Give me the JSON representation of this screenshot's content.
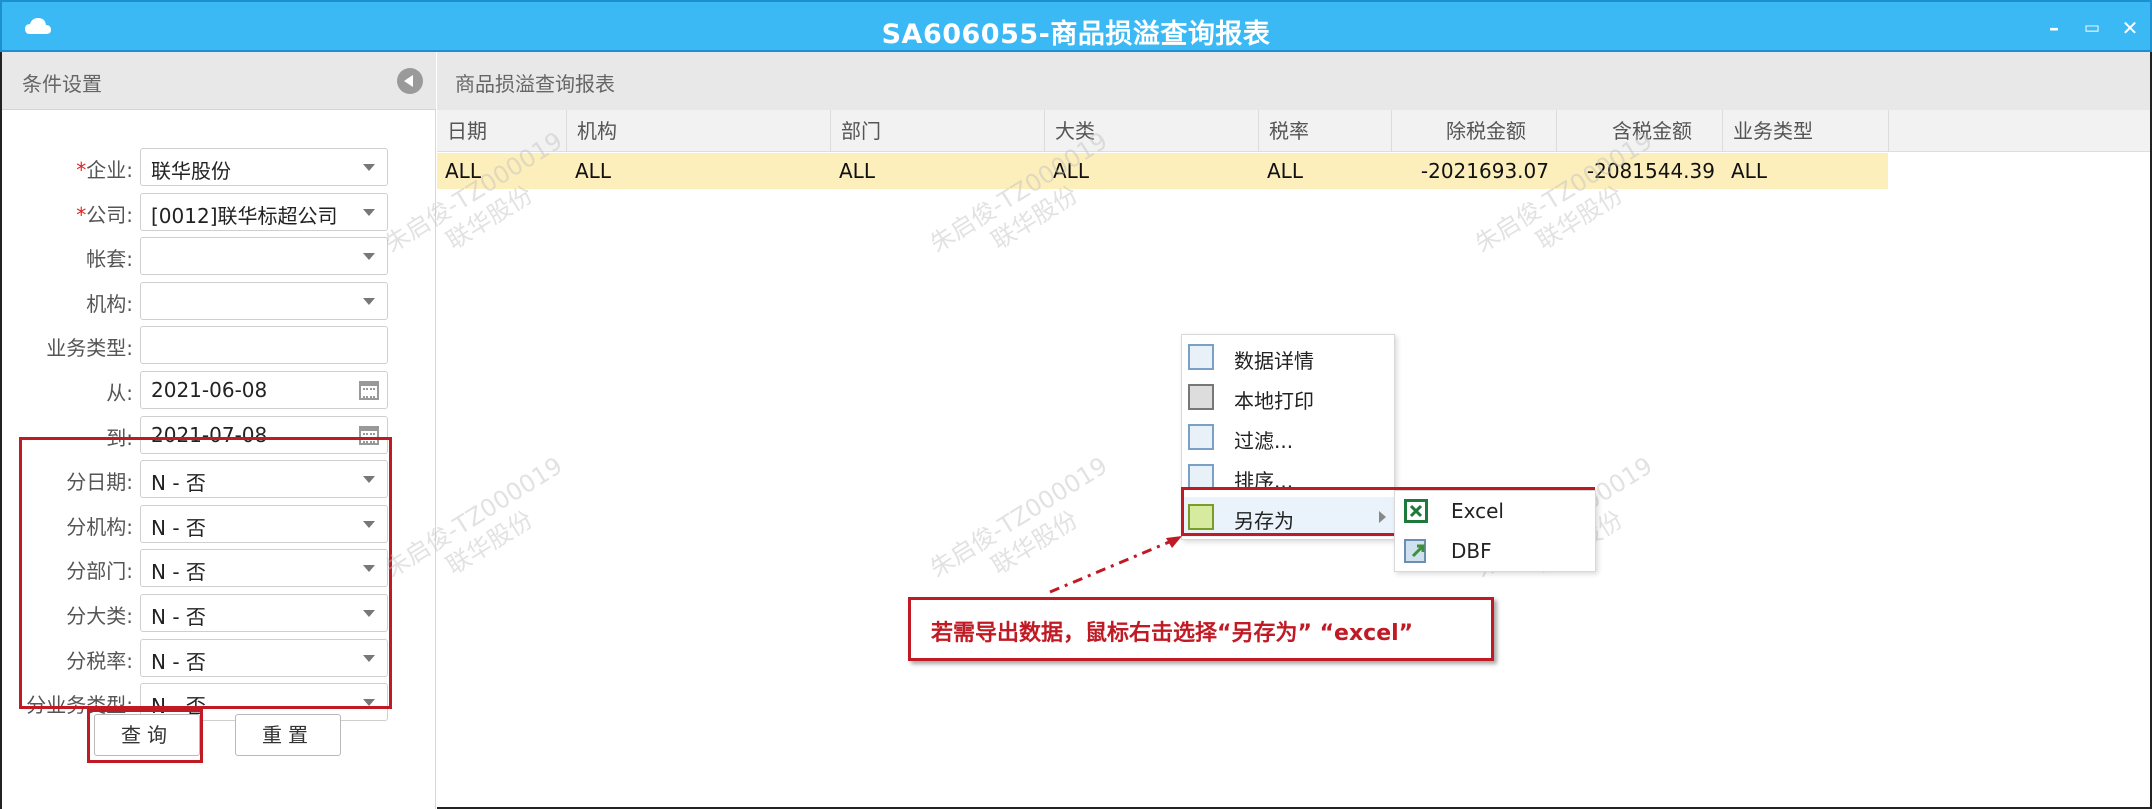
{
  "window": {
    "title": "SA606055-商品损溢查询报表",
    "minimize": "–",
    "restore": "▭",
    "close": "✕"
  },
  "left_panel": {
    "title": "条件设置",
    "fields": [
      {
        "label": "企业:",
        "required": true,
        "value": "联华股份",
        "type": "select"
      },
      {
        "label": "公司:",
        "required": true,
        "value": "[0012]联华标超公司",
        "type": "select"
      },
      {
        "label": "帐套:",
        "required": false,
        "value": "",
        "type": "select"
      },
      {
        "label": "机构:",
        "required": false,
        "value": "",
        "type": "select"
      },
      {
        "label": "业务类型:",
        "required": false,
        "value": "",
        "type": "text"
      },
      {
        "label": "从:",
        "required": false,
        "value": "2021-06-08",
        "type": "date"
      },
      {
        "label": "到:",
        "required": false,
        "value": "2021-07-08",
        "type": "date"
      },
      {
        "label": "分日期:",
        "required": false,
        "value": "N - 否",
        "type": "select"
      },
      {
        "label": "分机构:",
        "required": false,
        "value": "N - 否",
        "type": "select"
      },
      {
        "label": "分部门:",
        "required": false,
        "value": "N - 否",
        "type": "select"
      },
      {
        "label": "分大类:",
        "required": false,
        "value": "N - 否",
        "type": "select"
      },
      {
        "label": "分税率:",
        "required": false,
        "value": "N - 否",
        "type": "select"
      },
      {
        "label": "分业务类型:",
        "required": false,
        "value": "N - 否",
        "type": "select"
      }
    ],
    "query_button": "查询",
    "reset_button": "重置"
  },
  "report": {
    "title": "商品损溢查询报表",
    "columns": [
      "日期",
      "机构",
      "部门",
      "大类",
      "税率",
      "除税金额",
      "含税金额",
      "业务类型"
    ],
    "rows": [
      [
        "ALL",
        "ALL",
        "ALL",
        "ALL",
        "ALL",
        "-2021693.07",
        "-2081544.39",
        "ALL"
      ]
    ]
  },
  "context_menu": {
    "items": [
      "数据详情",
      "本地打印",
      "过滤...",
      "排序...",
      "另存为"
    ],
    "submenu": [
      "Excel",
      "DBF"
    ]
  },
  "callout": {
    "text": "若需导出数据，鼠标右击选择“另存为” “excel”"
  },
  "watermark": {
    "line1": "朱启俊-TZ000019",
    "line2": "联华股份"
  },
  "colors": {
    "titlebar": "#3ab9f5",
    "highlight_row": "#fdefbc",
    "annotation_red": "#c01a24"
  }
}
